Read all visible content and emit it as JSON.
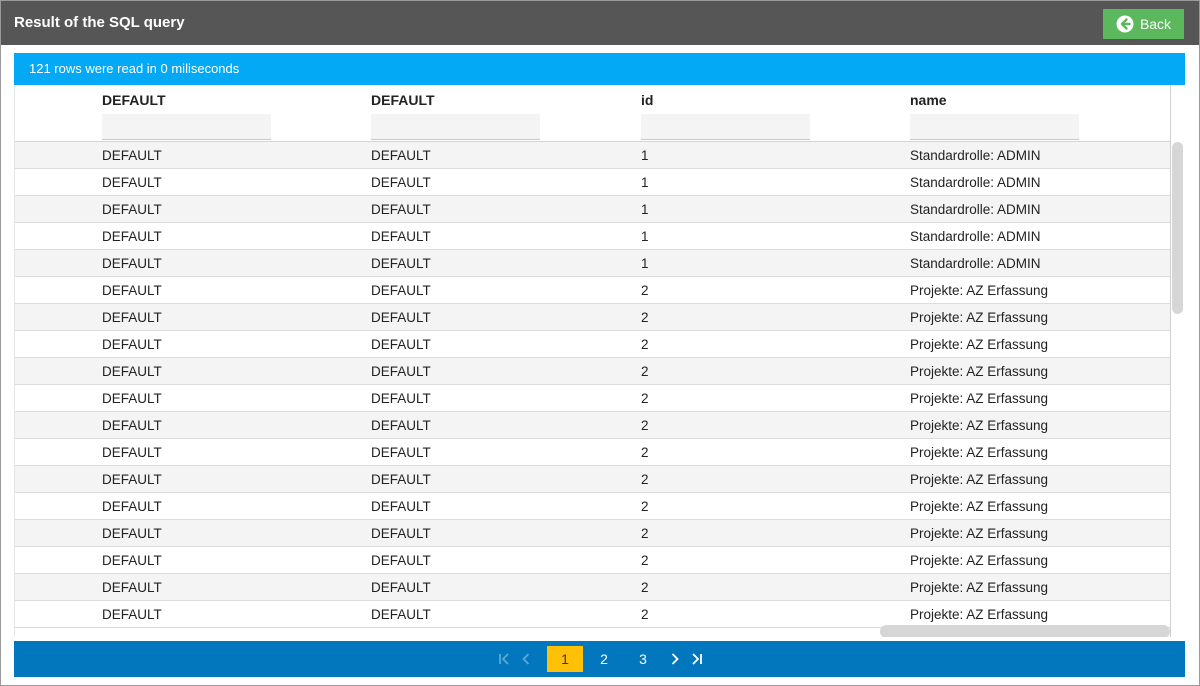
{
  "header": {
    "title": "Result of the SQL query",
    "back_label": "Back"
  },
  "info": {
    "message": "121 rows were read in 0 miliseconds"
  },
  "columns": [
    {
      "label": "DEFAULT",
      "filter_value": ""
    },
    {
      "label": "DEFAULT",
      "filter_value": ""
    },
    {
      "label": "id",
      "filter_value": ""
    },
    {
      "label": "name",
      "filter_value": ""
    }
  ],
  "rows": [
    [
      "DEFAULT",
      "DEFAULT",
      "1",
      "Standardrolle: ADMIN"
    ],
    [
      "DEFAULT",
      "DEFAULT",
      "1",
      "Standardrolle: ADMIN"
    ],
    [
      "DEFAULT",
      "DEFAULT",
      "1",
      "Standardrolle: ADMIN"
    ],
    [
      "DEFAULT",
      "DEFAULT",
      "1",
      "Standardrolle: ADMIN"
    ],
    [
      "DEFAULT",
      "DEFAULT",
      "1",
      "Standardrolle: ADMIN"
    ],
    [
      "DEFAULT",
      "DEFAULT",
      "2",
      "Projekte: AZ Erfassung"
    ],
    [
      "DEFAULT",
      "DEFAULT",
      "2",
      "Projekte: AZ Erfassung"
    ],
    [
      "DEFAULT",
      "DEFAULT",
      "2",
      "Projekte: AZ Erfassung"
    ],
    [
      "DEFAULT",
      "DEFAULT",
      "2",
      "Projekte: AZ Erfassung"
    ],
    [
      "DEFAULT",
      "DEFAULT",
      "2",
      "Projekte: AZ Erfassung"
    ],
    [
      "DEFAULT",
      "DEFAULT",
      "2",
      "Projekte: AZ Erfassung"
    ],
    [
      "DEFAULT",
      "DEFAULT",
      "2",
      "Projekte: AZ Erfassung"
    ],
    [
      "DEFAULT",
      "DEFAULT",
      "2",
      "Projekte: AZ Erfassung"
    ],
    [
      "DEFAULT",
      "DEFAULT",
      "2",
      "Projekte: AZ Erfassung"
    ],
    [
      "DEFAULT",
      "DEFAULT",
      "2",
      "Projekte: AZ Erfassung"
    ],
    [
      "DEFAULT",
      "DEFAULT",
      "2",
      "Projekte: AZ Erfassung"
    ],
    [
      "DEFAULT",
      "DEFAULT",
      "2",
      "Projekte: AZ Erfassung"
    ],
    [
      "DEFAULT",
      "DEFAULT",
      "2",
      "Projekte: AZ Erfassung"
    ]
  ],
  "pagination": {
    "pages": [
      "1",
      "2",
      "3"
    ],
    "current_page": "1",
    "icons": {
      "first": "first-page-icon",
      "prev": "previous-page-icon",
      "next": "next-page-icon",
      "last": "last-page-icon"
    }
  },
  "colors": {
    "titlebar": "#565656",
    "back_button": "#5cb85c",
    "info_bar": "#03a9f4",
    "pager": "#0277bd",
    "active_page": "#ffc107"
  }
}
